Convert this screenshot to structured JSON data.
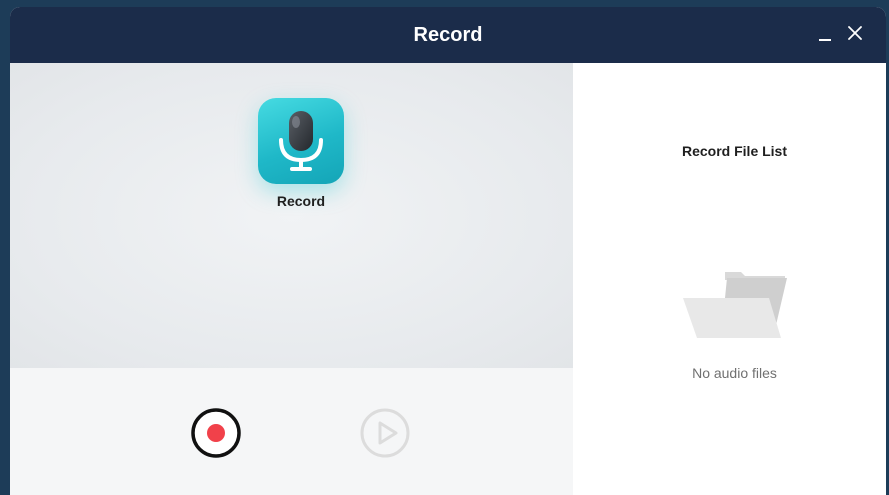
{
  "window": {
    "title": "Record"
  },
  "recorder": {
    "app_label": "Record",
    "record_button": "record-button",
    "play_button": "play-button"
  },
  "file_list": {
    "title": "Record File List",
    "empty_text": "No audio files"
  },
  "colors": {
    "titlebar": "#1b2c4a",
    "accent_teal": "#1fb8c8",
    "record_red": "#f1414a"
  },
  "icons": {
    "minimize": "minimize-icon",
    "close": "close-icon",
    "microphone": "microphone-icon",
    "record": "record-icon",
    "play": "play-icon",
    "folder": "empty-folder-icon"
  }
}
